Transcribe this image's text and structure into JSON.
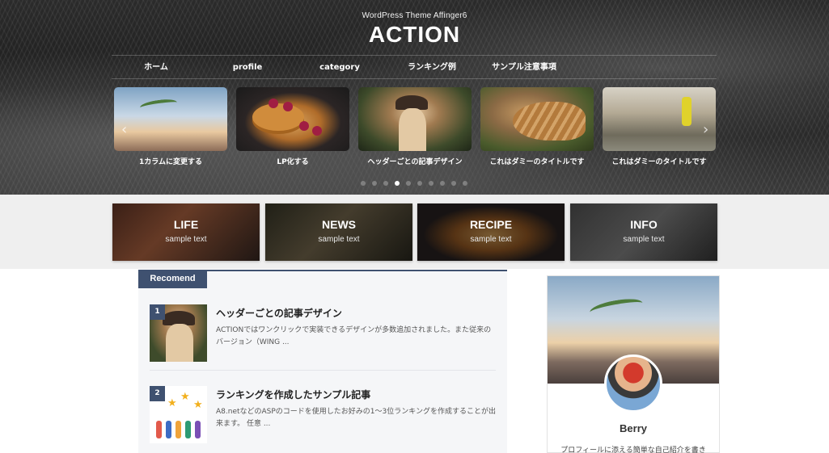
{
  "header": {
    "tagline": "WordPress Theme Affinger6",
    "logo": "ACTION"
  },
  "nav": {
    "items": [
      {
        "label": "ホーム"
      },
      {
        "label": "profile"
      },
      {
        "label": "category"
      },
      {
        "label": "ランキング例"
      },
      {
        "label": "サンプル注意事項"
      }
    ]
  },
  "slider": {
    "prev_icon": "‹",
    "next_icon": "›",
    "slides": [
      {
        "caption": "1カラムに変更する"
      },
      {
        "caption": "LP化する"
      },
      {
        "caption": "ヘッダーごとの記事デザイン"
      },
      {
        "caption": "これはダミーのタイトルです"
      },
      {
        "caption": "これはダミーのタイトルです"
      }
    ],
    "dot_count": 10,
    "active_dot": 3
  },
  "categories": [
    {
      "title": "LIFE",
      "subtitle": "sample text"
    },
    {
      "title": "NEWS",
      "subtitle": "sample text"
    },
    {
      "title": "RECIPE",
      "subtitle": "sample text"
    },
    {
      "title": "INFO",
      "subtitle": "sample text"
    }
  ],
  "recommend": {
    "tab_label": "Recomend",
    "posts": [
      {
        "rank": "1",
        "title": "ヘッダーごとの記事デザイン",
        "excerpt": "ACTIONではワンクリックで実装できるデザインが多数追加されました。また従来のバージョン（WING ..."
      },
      {
        "rank": "2",
        "title": "ランキングを作成したサンプル記事",
        "excerpt": "A8.netなどのASPのコードを使用したお好みの1〜3位ランキングを作成することが出来ます。 任意 ..."
      }
    ]
  },
  "profile": {
    "name": "Berry",
    "description": "プロフィールに添える簡単な自己紹介を書き"
  },
  "colors": {
    "accent": "#3f5170",
    "band": "#efefef",
    "content_bg": "#f5f6f8"
  }
}
